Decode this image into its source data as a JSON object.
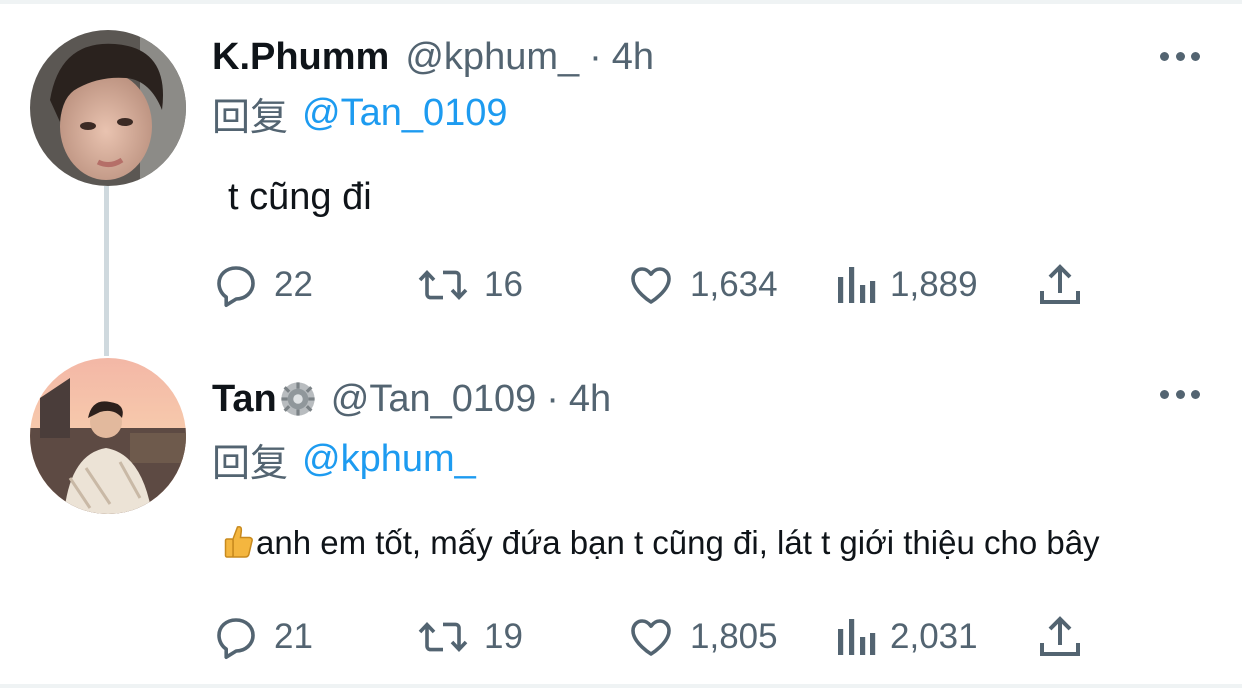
{
  "tweets": [
    {
      "display_name": "K.Phumm",
      "handle": "@kphum_",
      "separator": "·",
      "time": "4h",
      "reply_prefix": "回复",
      "reply_to": "@Tan_0109",
      "text": "t cũng đi",
      "stats": {
        "replies": "22",
        "retweets": "16",
        "likes": "1,634",
        "views": "1,889"
      }
    },
    {
      "display_name": "Tan",
      "handle": "@Tan_0109",
      "separator": "·",
      "time": "4h",
      "reply_prefix": "回复",
      "reply_to": "@kphum_",
      "text": "anh em tốt, mấy đứa bạn t cũng đi, lát t giới thiệu cho bây",
      "stats": {
        "replies": "21",
        "retweets": "19",
        "likes": "1,805",
        "views": "2,031"
      }
    }
  ],
  "icons": {
    "reply": "reply-icon",
    "retweet": "retweet-icon",
    "like": "heart-icon",
    "views": "views-icon",
    "share": "share-icon",
    "more": "more-icon",
    "badge": "gear-badge-icon",
    "emoji": "thumbs-up-emoji"
  },
  "colors": {
    "text": "#0f1419",
    "secondary": "#536471",
    "link": "#1d9bf0",
    "thread_line": "#cfd9de",
    "thumb": "#f4b63f"
  }
}
